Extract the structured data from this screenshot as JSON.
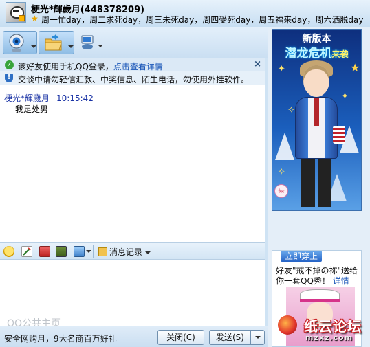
{
  "header": {
    "contact_name": "梗光*輝歲月(448378209)",
    "signature": "周一忙day，周二求死day，周三未死day，周四受死day，周五福来day，周六洒脱day"
  },
  "toolbar": {
    "buttons": [
      "video-call",
      "send-file",
      "remote-assist"
    ]
  },
  "notices": {
    "mobile_text": "该好友使用手机QQ登录，",
    "mobile_link": "点击查看详情",
    "close": "×",
    "safety_text": "交谈中请勿轻信汇款、中奖信息、陌生电话，勿使用外挂软件。"
  },
  "messages": [
    {
      "sender": "梗光*輝歲月",
      "time": "10:15:42",
      "text": "我是处男"
    }
  ],
  "input_toolbar": {
    "history_label": "消息记录"
  },
  "bottom": {
    "promo_text": "安全网购月，9大名商百万好礼",
    "close_label": "关闭(C)",
    "send_label": "发送(S)"
  },
  "watermark": "QQ公共主页",
  "show_panel": {
    "banner_line1": "新版本",
    "banner_line2": "潜龙危机",
    "banner_line2_small": "来袭"
  },
  "ad": {
    "button_label": "立即穿上",
    "line1": "好友\"戒不掉の祢\"送给",
    "line2": "你一套QQ秀！",
    "link": "详情"
  },
  "logo": {
    "main": "纸云论坛",
    "sub": "mzxz.com"
  },
  "colors": {
    "accent_blue": "#1a56b8",
    "sender_blue": "#1a33a5",
    "header_bg": "#c7def2"
  }
}
